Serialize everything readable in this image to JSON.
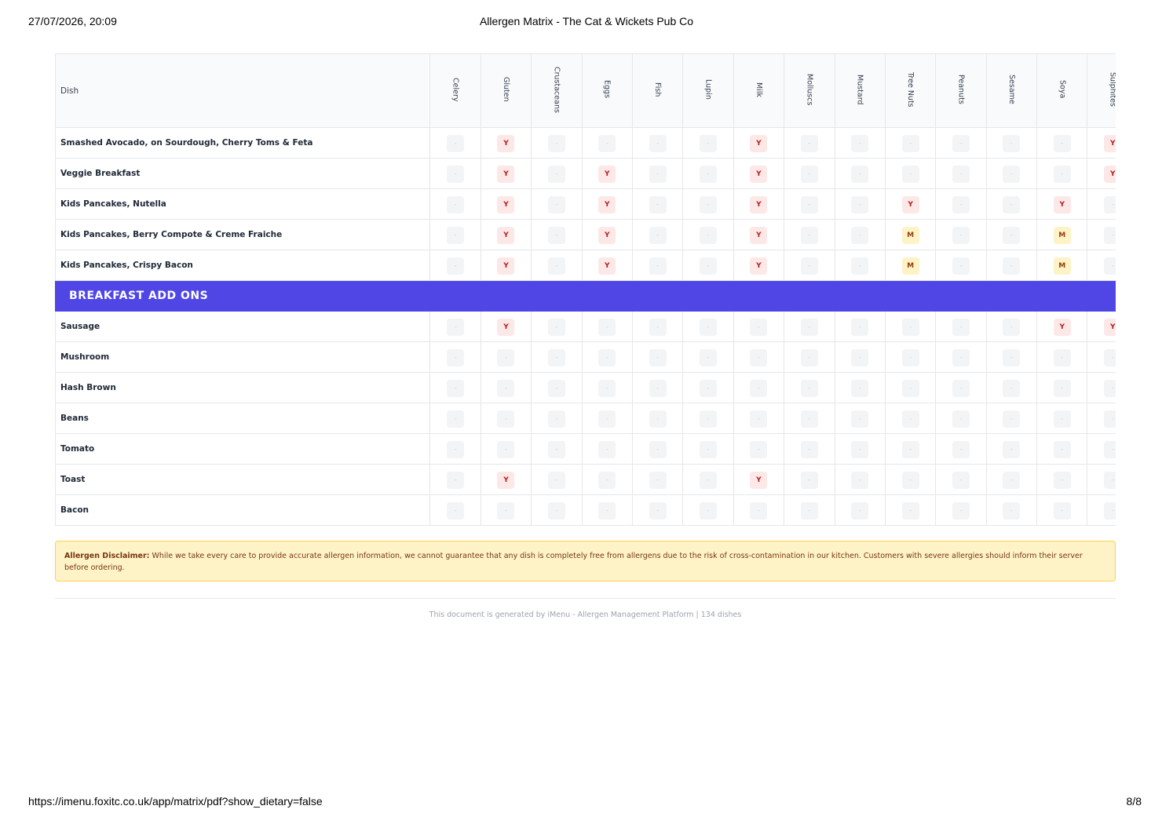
{
  "print": {
    "datetime": "27/07/2026, 20:09",
    "title": "Allergen Matrix - The Cat & Wickets Pub Co",
    "url": "https://imenu.foxitc.co.uk/app/matrix/pdf?show_dietary=false",
    "page": "8/8"
  },
  "matrix": {
    "dish_header": "Dish",
    "allergens": [
      "Celery",
      "Gluten",
      "Crustaceans",
      "Eggs",
      "Fish",
      "Lupin",
      "Milk",
      "Molluscs",
      "Mustard",
      "Tree Nuts",
      "Peanuts",
      "Sesame",
      "Soya",
      "Sulphites"
    ],
    "colors": {
      "section": "#4f46e5",
      "contains": "#b91c1c",
      "may_contain": "#92400e"
    },
    "rows": [
      {
        "type": "dish",
        "name": "Smashed Avocado, on Sourdough, Cherry Toms & Feta",
        "values": [
          "-",
          "Y",
          "-",
          "-",
          "-",
          "-",
          "Y",
          "-",
          "-",
          "-",
          "-",
          "-",
          "-",
          "Y"
        ]
      },
      {
        "type": "dish",
        "name": "Veggie Breakfast",
        "values": [
          "-",
          "Y",
          "-",
          "Y",
          "-",
          "-",
          "Y",
          "-",
          "-",
          "-",
          "-",
          "-",
          "-",
          "Y"
        ]
      },
      {
        "type": "dish",
        "name": "Kids Pancakes, Nutella",
        "values": [
          "-",
          "Y",
          "-",
          "Y",
          "-",
          "-",
          "Y",
          "-",
          "-",
          "Y",
          "-",
          "-",
          "Y",
          "-"
        ]
      },
      {
        "type": "dish",
        "name": "Kids Pancakes, Berry Compote & Creme Fraiche",
        "values": [
          "-",
          "Y",
          "-",
          "Y",
          "-",
          "-",
          "Y",
          "-",
          "-",
          "M",
          "-",
          "-",
          "M",
          "-"
        ]
      },
      {
        "type": "dish",
        "name": "Kids Pancakes, Crispy Bacon",
        "values": [
          "-",
          "Y",
          "-",
          "Y",
          "-",
          "-",
          "Y",
          "-",
          "-",
          "M",
          "-",
          "-",
          "M",
          "-"
        ]
      },
      {
        "type": "section",
        "name": "BREAKFAST ADD ONS"
      },
      {
        "type": "dish",
        "name": "Sausage",
        "values": [
          "-",
          "Y",
          "-",
          "-",
          "-",
          "-",
          "-",
          "-",
          "-",
          "-",
          "-",
          "-",
          "Y",
          "Y"
        ]
      },
      {
        "type": "dish",
        "name": "Mushroom",
        "values": [
          "-",
          "-",
          "-",
          "-",
          "-",
          "-",
          "-",
          "-",
          "-",
          "-",
          "-",
          "-",
          "-",
          "-"
        ]
      },
      {
        "type": "dish",
        "name": "Hash Brown",
        "values": [
          "-",
          "-",
          "-",
          "-",
          "-",
          "-",
          "-",
          "-",
          "-",
          "-",
          "-",
          "-",
          "-",
          "-"
        ]
      },
      {
        "type": "dish",
        "name": "Beans",
        "values": [
          "-",
          "-",
          "-",
          "-",
          "-",
          "-",
          "-",
          "-",
          "-",
          "-",
          "-",
          "-",
          "-",
          "-"
        ]
      },
      {
        "type": "dish",
        "name": "Tomato",
        "values": [
          "-",
          "-",
          "-",
          "-",
          "-",
          "-",
          "-",
          "-",
          "-",
          "-",
          "-",
          "-",
          "-",
          "-"
        ]
      },
      {
        "type": "dish",
        "name": "Toast",
        "values": [
          "-",
          "Y",
          "-",
          "-",
          "-",
          "-",
          "Y",
          "-",
          "-",
          "-",
          "-",
          "-",
          "-",
          "-"
        ]
      },
      {
        "type": "dish",
        "name": "Bacon",
        "values": [
          "-",
          "-",
          "-",
          "-",
          "-",
          "-",
          "-",
          "-",
          "-",
          "-",
          "-",
          "-",
          "-",
          "-"
        ]
      }
    ]
  },
  "disclaimer": {
    "label": "Allergen Disclaimer:",
    "text": " While we take every care to provide accurate allergen information, we cannot guarantee that any dish is completely free from allergens due to the risk of cross-contamination in our kitchen. Customers with severe allergies should inform their server before ordering."
  },
  "footer": {
    "note": "This document is generated by iMenu - Allergen Management Platform | 134 dishes"
  }
}
